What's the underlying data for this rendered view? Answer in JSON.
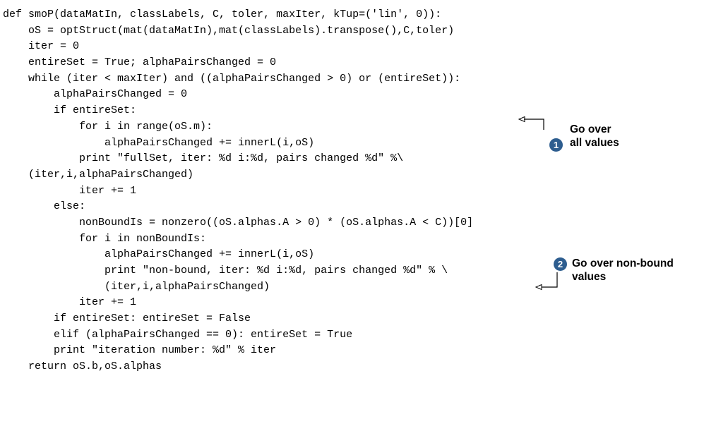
{
  "colors": {
    "badge": "#2d5d8f",
    "text": "#000000",
    "background": "#ffffff"
  },
  "code_lines": [
    "def smoP(dataMatIn, classLabels, C, toler, maxIter, kTup=('lin', 0)):",
    "    oS = optStruct(mat(dataMatIn),mat(classLabels).transpose(),C,toler)",
    "    iter = 0",
    "    entireSet = True; alphaPairsChanged = 0",
    "    while (iter < maxIter) and ((alphaPairsChanged > 0) or (entireSet)):",
    "        alphaPairsChanged = 0",
    "        if entireSet:",
    "            for i in range(oS.m):",
    "                alphaPairsChanged += innerL(i,oS)",
    "            print \"fullSet, iter: %d i:%d, pairs changed %d\" %\\",
    "    (iter,i,alphaPairsChanged)",
    "            iter += 1",
    "        else:",
    "            nonBoundIs = nonzero((oS.alphas.A > 0) * (oS.alphas.A < C))[0]",
    "            for i in nonBoundIs:",
    "                alphaPairsChanged += innerL(i,oS)",
    "                print \"non-bound, iter: %d i:%d, pairs changed %d\" % \\",
    "                (iter,i,alphaPairsChanged)",
    "            iter += 1",
    "        if entireSet: entireSet = False",
    "        elif (alphaPairsChanged == 0): entireSet = True",
    "        print \"iteration number: %d\" % iter",
    "    return oS.b,oS.alphas"
  ],
  "annotations": [
    {
      "number": "1",
      "lines": [
        "Go over",
        "all values"
      ]
    },
    {
      "number": "2",
      "lines": [
        "Go over non-bound",
        "values"
      ]
    }
  ]
}
